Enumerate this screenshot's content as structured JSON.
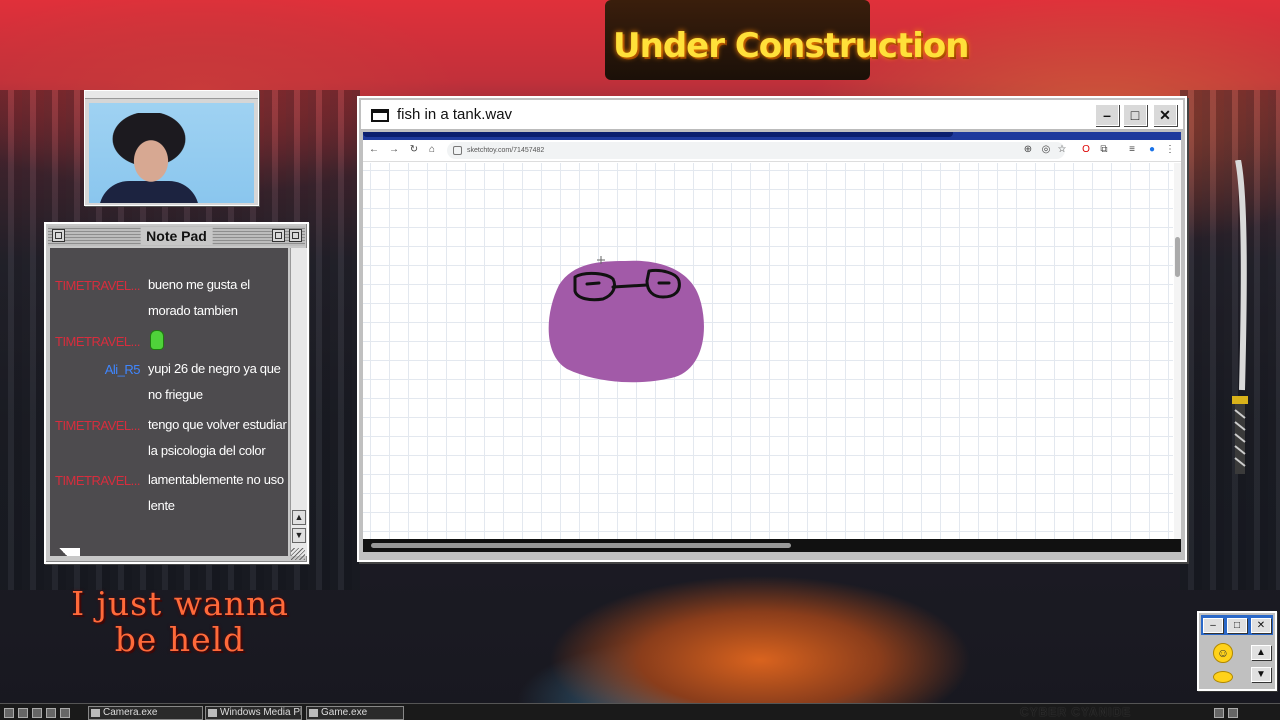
{
  "desktop": {
    "banner": "Under Construction",
    "big_text_line1": "I just wanna",
    "big_text_line2": "be held",
    "brand": "CYBER CYANIDE"
  },
  "notepad": {
    "title": "Note Pad",
    "messages": [
      {
        "user": "TIMETRAVEL...",
        "text": "bueno me gusta el morado tambien",
        "user_color": "#d72d3d"
      },
      {
        "user": "TIMETRAVEL...",
        "text": "",
        "emote": "green-angel-emote",
        "user_color": "#d72d3d"
      },
      {
        "user": "Ali_R5",
        "text": "yupi 26 de negro ya que no friegue",
        "user_color": "#3f86ff"
      },
      {
        "user": "TIMETRAVEL...",
        "text": "tengo que volver estudiar la psicologia del color",
        "user_color": "#d72d3d"
      },
      {
        "user": "TIMETRAVEL...",
        "text": "lamentablemente no uso lente",
        "user_color": "#d72d3d"
      }
    ]
  },
  "main_window": {
    "title": "fish in a tank.wav",
    "url": "sketchtoy.com/71457482"
  },
  "drawing": {
    "blob_color": "#a25aa8"
  },
  "taskbar": {
    "items": [
      "Camera.exe",
      "Windows Media Pla",
      "Game.exe"
    ]
  }
}
